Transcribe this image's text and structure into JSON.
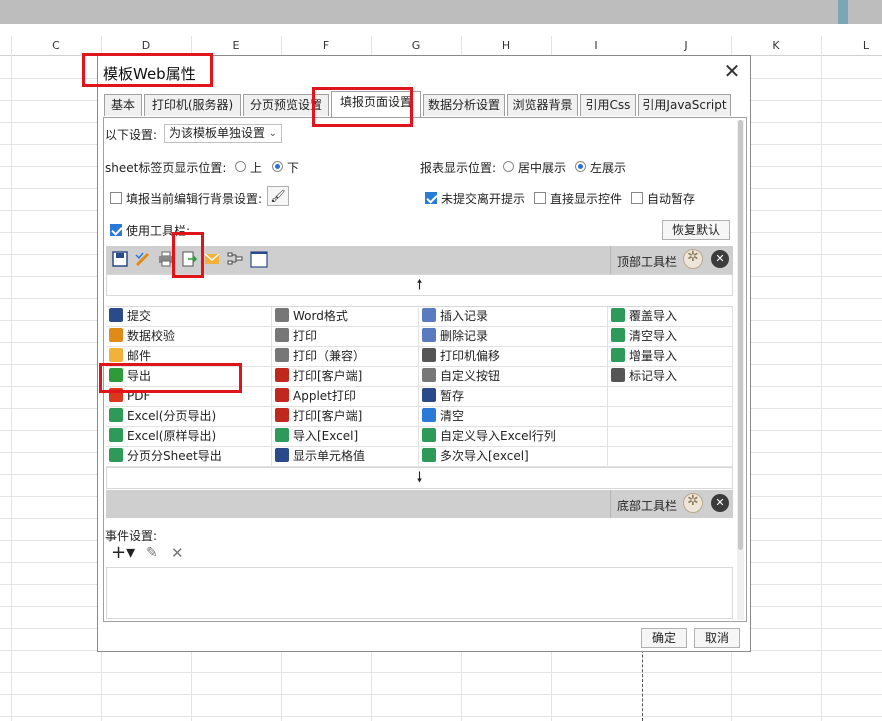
{
  "spreadsheet": {
    "columns": [
      "C",
      "D",
      "E",
      "F",
      "G",
      "H",
      "I",
      "J",
      "K",
      "L"
    ]
  },
  "dialog": {
    "title": "模板Web属性",
    "close_icon": "close-icon",
    "tabs": [
      {
        "label": "基本",
        "active": false
      },
      {
        "label": "打印机(服务器)",
        "active": false
      },
      {
        "label": "分页预览设置",
        "active": false
      },
      {
        "label": "填报页面设置",
        "active": true
      },
      {
        "label": "数据分析设置",
        "active": false
      },
      {
        "label": "浏览器背景",
        "active": false
      },
      {
        "label": "引用Css",
        "active": false
      },
      {
        "label": "引用JavaScript",
        "active": false
      }
    ],
    "settings": {
      "scope_label": "以下设置:",
      "scope_value": "为该模板单独设置",
      "sheet_tab_label": "sheet标签页显示位置:",
      "sheet_tab_options": [
        "上",
        "下"
      ],
      "sheet_tab_selected": "下",
      "report_pos_label": "报表显示位置:",
      "report_pos_options": [
        "居中展示",
        "左展示"
      ],
      "report_pos_selected": "左展示",
      "row_bg_label": "填报当前编辑行背景设置:",
      "row_bg_checked": false,
      "unsubmitted_label": "未提交离开提示",
      "unsubmitted_checked": true,
      "show_controls_label": "直接显示控件",
      "show_controls_checked": false,
      "autosave_label": "自动暂存",
      "autosave_checked": false,
      "use_toolbar_label": "使用工具栏:",
      "use_toolbar_checked": true,
      "reset_button": "恢复默认"
    },
    "top_toolbar_label": "顶部工具栏",
    "bottom_toolbar_label": "底部工具栏",
    "toolbar_icons": [
      "save-icon",
      "pencil-check-icon",
      "printer-icon",
      "export-icon",
      "email-icon",
      "tree-icon",
      "window-icon"
    ],
    "buttons_grid": [
      [
        "提交",
        "Word格式",
        "插入记录",
        "覆盖导入"
      ],
      [
        "数据校验",
        "打印",
        "删除记录",
        "清空导入"
      ],
      [
        "邮件",
        "打印（兼容）",
        "打印机偏移",
        "增量导入"
      ],
      [
        "导出",
        "打印[客户端]",
        "自定义按钮",
        "标记导入"
      ],
      [
        "PDF",
        "Applet打印",
        "暂存",
        ""
      ],
      [
        "Excel(分页导出)",
        "打印[客户端]",
        "清空",
        ""
      ],
      [
        "Excel(原样导出)",
        "导入[Excel]",
        "自定义导入Excel行列",
        ""
      ],
      [
        "分页分Sheet导出",
        "显示单元格值",
        "多次导入[excel]",
        ""
      ]
    ],
    "event_label": "事件设置:",
    "ok_button": "确定",
    "cancel_button": "取消"
  },
  "colors": {
    "highlight_red": "#e0141b",
    "toolbar_gray": "#cfcfcf",
    "accent_blue": "#2a7ad8"
  }
}
